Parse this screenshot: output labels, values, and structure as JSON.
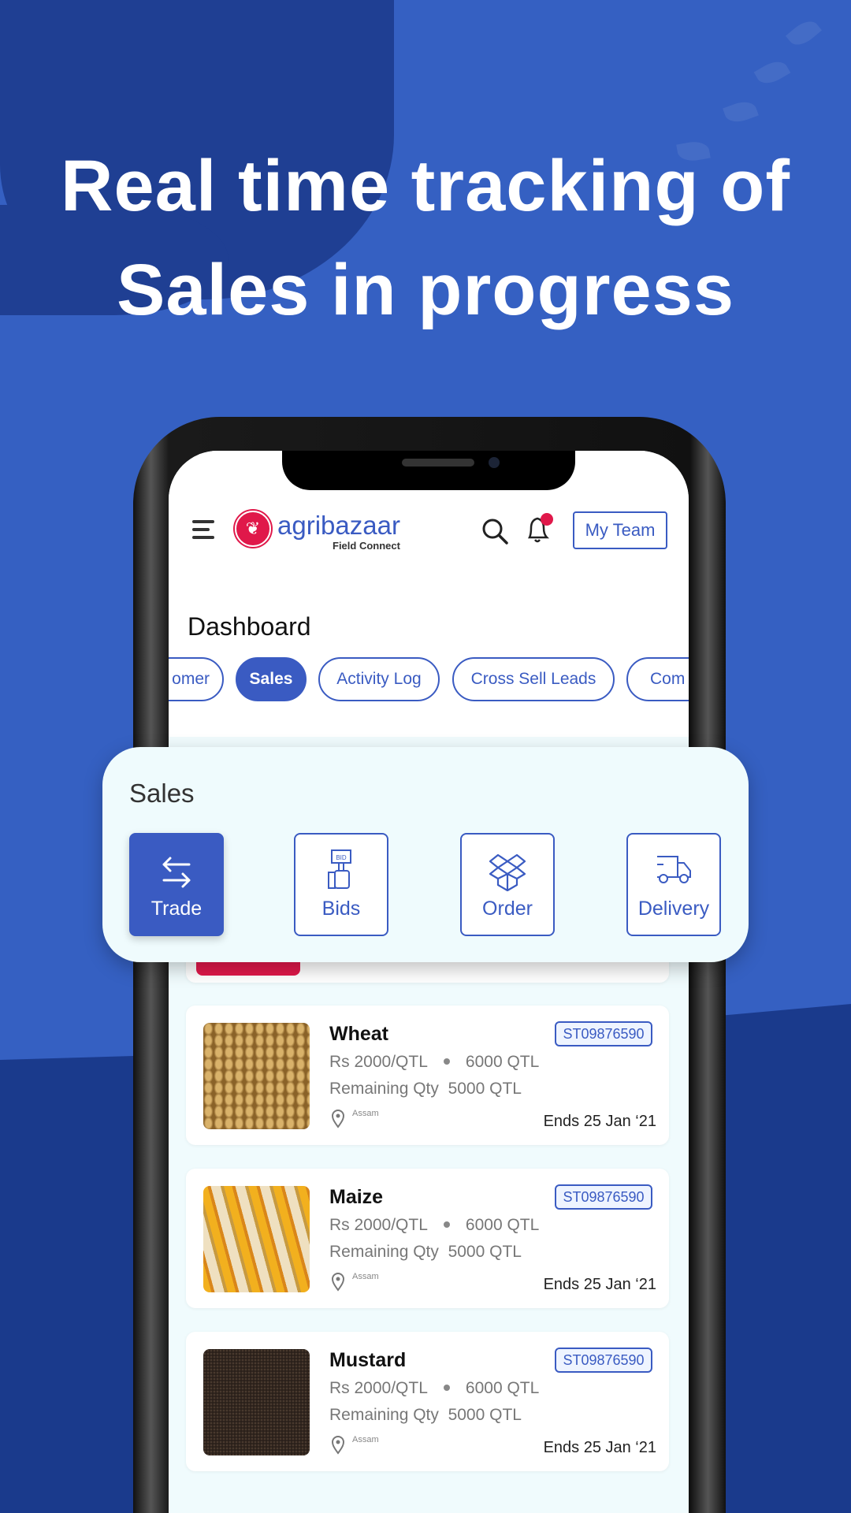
{
  "headline": {
    "line1": "Real time tracking of",
    "line2": "Sales in progress"
  },
  "colors": {
    "background": "#3560c2",
    "accent": "#3a5bc2",
    "brand_red": "#e0184a",
    "notification": "#e0184a"
  },
  "app": {
    "brand": "agribazaar",
    "subtitle": "Field Connect",
    "my_team_label": "My Team",
    "icons": [
      "menu-icon",
      "search-icon",
      "bell-icon"
    ]
  },
  "dashboard": {
    "title": "Dashboard",
    "tabs": [
      {
        "label": "Customer",
        "visible": "omer",
        "active": false
      },
      {
        "label": "Sales",
        "active": true
      },
      {
        "label": "Activity Log",
        "active": false
      },
      {
        "label": "Cross Sell Leads",
        "active": false
      },
      {
        "label": "Com",
        "active": false
      }
    ]
  },
  "sales_panel": {
    "title": "Sales",
    "items": [
      {
        "label": "Trade",
        "icon": "swap-arrows-icon",
        "active": true
      },
      {
        "label": "Bids",
        "icon": "bid-hammer-icon",
        "active": false
      },
      {
        "label": "Order",
        "icon": "box-icon",
        "active": false
      },
      {
        "label": "Delivery",
        "icon": "truck-icon",
        "active": false
      }
    ]
  },
  "listings": [
    {
      "title": "Wheat",
      "price": "Rs 2000/QTL",
      "qty": "6000 QTL",
      "remaining_label": "Remaining Qty",
      "remaining": "5000 QTL",
      "location": "Assam",
      "id": "ST09876590",
      "ends": "Ends 25 Jan ‘21"
    },
    {
      "title": "Maize",
      "price": "Rs 2000/QTL",
      "qty": "6000 QTL",
      "remaining_label": "Remaining Qty",
      "remaining": "5000 QTL",
      "location": "Assam",
      "id": "ST09876590",
      "ends": "Ends 25 Jan ‘21"
    },
    {
      "title": "Mustard",
      "price": "Rs 2000/QTL",
      "qty": "6000 QTL",
      "remaining_label": "Remaining Qty",
      "remaining": "5000 QTL",
      "location": "Assam",
      "id": "ST09876590",
      "ends": "Ends 25 Jan ‘21"
    }
  ]
}
